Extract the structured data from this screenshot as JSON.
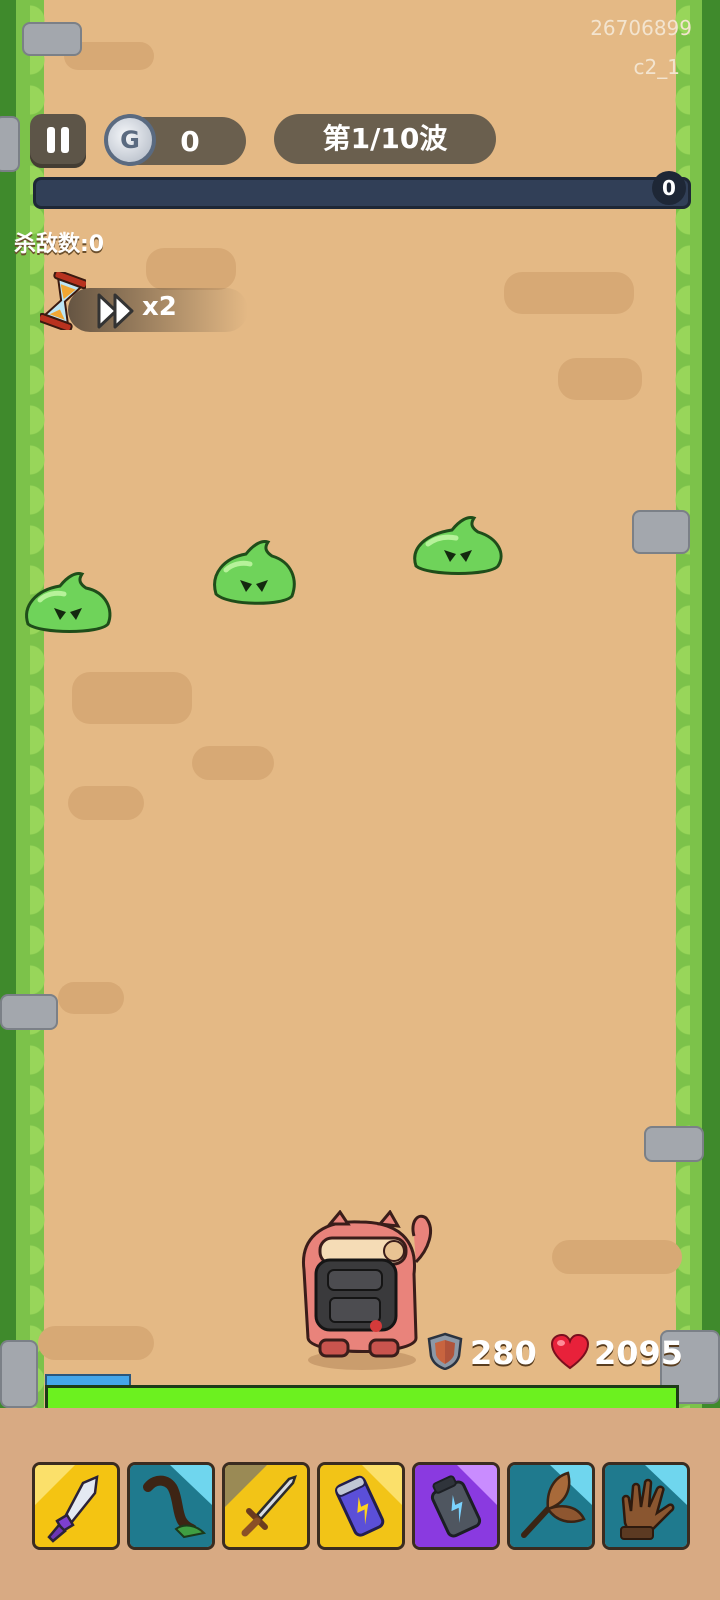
{
  "hud": {
    "session_id": "26706899",
    "version_label": "c2_1",
    "coins": "0",
    "wave_label": "第1/10波",
    "progress_value": "0",
    "kills_label": "杀敌数:0",
    "speed_label": "x2"
  },
  "player": {
    "defense": "280",
    "health": "2095",
    "health_fraction": 1.0,
    "mana_fraction": 0.13
  },
  "colors": {
    "path": "#e4b985",
    "grass": "#7cc24a",
    "slime": "#6fd35a",
    "health_bar": "#6cf11f",
    "mana_bar": "#45a6ea",
    "dock": "#d8aa83"
  },
  "enemies": [
    {
      "type": "green-slime"
    },
    {
      "type": "green-slime"
    },
    {
      "type": "green-slime"
    }
  ],
  "skills": [
    {
      "icon": "crystal-dagger-icon",
      "rarity": "gold"
    },
    {
      "icon": "scorpion-tail-icon",
      "rarity": "blue"
    },
    {
      "icon": "sword-icon",
      "rarity": "gold"
    },
    {
      "icon": "energy-drink-can-icon",
      "rarity": "gold"
    },
    {
      "icon": "battery-lantern-icon",
      "rarity": "purple"
    },
    {
      "icon": "leaf-fan-icon",
      "rarity": "blue"
    },
    {
      "icon": "leather-glove-icon",
      "rarity": "blue"
    }
  ]
}
